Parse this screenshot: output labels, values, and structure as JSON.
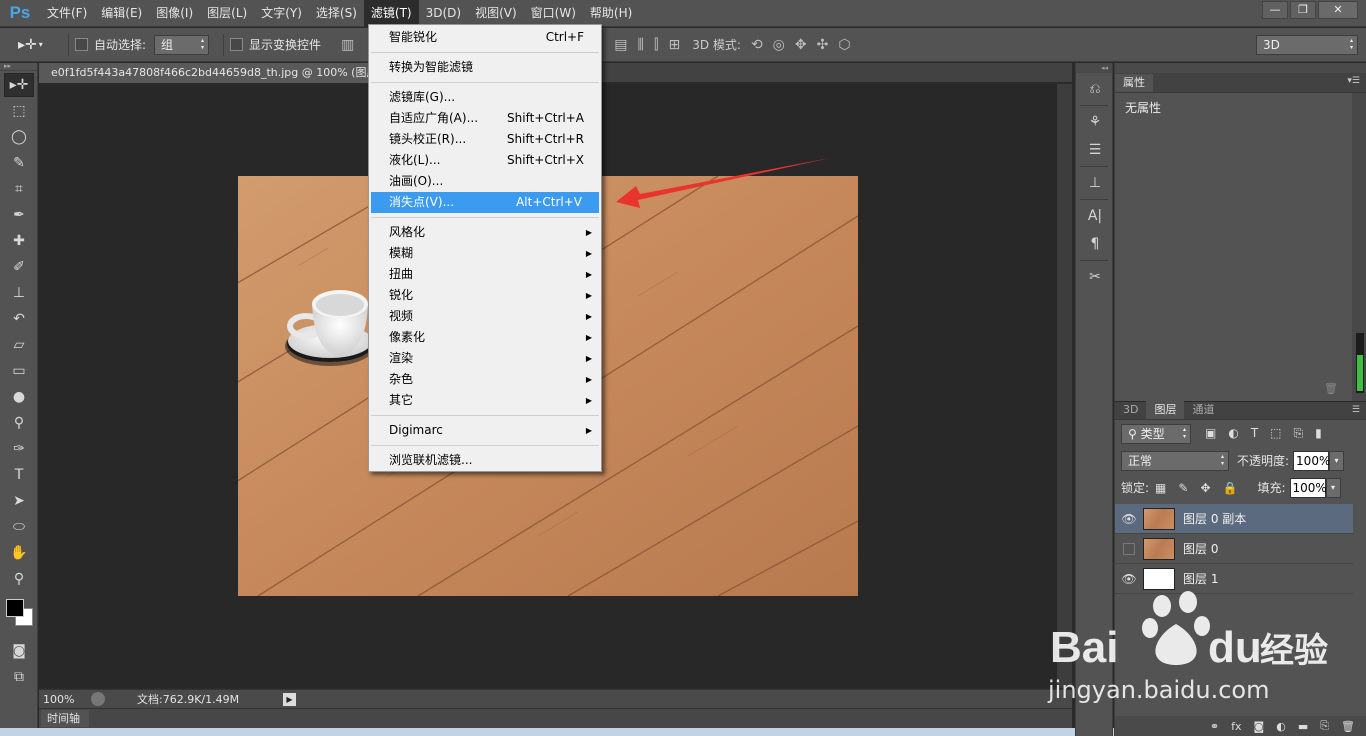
{
  "app": {
    "logo": "Ps"
  },
  "menubar": {
    "items": [
      "文件(F)",
      "编辑(E)",
      "图像(I)",
      "图层(L)",
      "文字(Y)",
      "选择(S)",
      "滤镜(T)",
      "3D(D)",
      "视图(V)",
      "窗口(W)",
      "帮助(H)"
    ],
    "active_index": 6
  },
  "window_controls": {
    "minimize": "—",
    "restore": "❐",
    "close": "✕"
  },
  "options_bar": {
    "auto_select_label": "自动选择:",
    "auto_select_value": "组",
    "show_transform_label": "显示变换控件",
    "mode3d_label": "3D 模式:",
    "workspace": "3D"
  },
  "document": {
    "tab_title": "e0f1fd5f443a47808f466c2bd44659d8_th.jpg @ 100% (图层",
    "zoom": "100%",
    "doc_size": "文档:762.9K/1.49M",
    "timeline_label": "时间轴"
  },
  "filter_menu": {
    "groups": [
      [
        {
          "label": "智能锐化",
          "shortcut": "Ctrl+F"
        }
      ],
      [
        {
          "label": "转换为智能滤镜",
          "shortcut": ""
        }
      ],
      [
        {
          "label": "滤镜库(G)...",
          "shortcut": ""
        },
        {
          "label": "自适应广角(A)...",
          "shortcut": "Shift+Ctrl+A"
        },
        {
          "label": "镜头校正(R)...",
          "shortcut": "Shift+Ctrl+R"
        },
        {
          "label": "液化(L)...",
          "shortcut": "Shift+Ctrl+X"
        },
        {
          "label": "油画(O)...",
          "shortcut": ""
        },
        {
          "label": "消失点(V)...",
          "shortcut": "Alt+Ctrl+V",
          "highlighted": true
        }
      ],
      [
        {
          "label": "风格化",
          "submenu": true
        },
        {
          "label": "模糊",
          "submenu": true
        },
        {
          "label": "扭曲",
          "submenu": true
        },
        {
          "label": "锐化",
          "submenu": true
        },
        {
          "label": "视频",
          "submenu": true
        },
        {
          "label": "像素化",
          "submenu": true
        },
        {
          "label": "渲染",
          "submenu": true
        },
        {
          "label": "杂色",
          "submenu": true
        },
        {
          "label": "其它",
          "submenu": true
        }
      ],
      [
        {
          "label": "Digimarc",
          "submenu": true
        }
      ],
      [
        {
          "label": "浏览联机滤镜...",
          "shortcut": ""
        }
      ]
    ]
  },
  "properties_panel": {
    "tab": "属性",
    "content": "无属性"
  },
  "layers_panel": {
    "tabs": [
      "3D",
      "图层",
      "通道"
    ],
    "active_tab": 1,
    "filter_kind": "类型",
    "blend_mode": "正常",
    "opacity_label": "不透明度:",
    "opacity": "100%",
    "lock_label": "锁定:",
    "fill_label": "填充:",
    "fill": "100%",
    "layers": [
      {
        "name": "图层 0 副本",
        "visible": true,
        "selected": true,
        "thumb": "wood"
      },
      {
        "name": "图层 0",
        "visible": false,
        "selected": false,
        "thumb": "wood"
      },
      {
        "name": "图层 1",
        "visible": true,
        "selected": false,
        "thumb": "white"
      }
    ],
    "footer_icons": [
      "link-icon",
      "fx-icon",
      "mask-icon",
      "adjustment-icon",
      "folder-icon",
      "new-layer-icon",
      "trash-icon"
    ]
  },
  "watermark": {
    "brand": "Bai du 经验",
    "url": "jingyan.baidu.com"
  },
  "colors": {
    "menu_highlight": "#3a9bf0",
    "arrow": "#e8342c",
    "ps_blue": "#49a6e6",
    "layer_selected": "#5b6a7e"
  }
}
